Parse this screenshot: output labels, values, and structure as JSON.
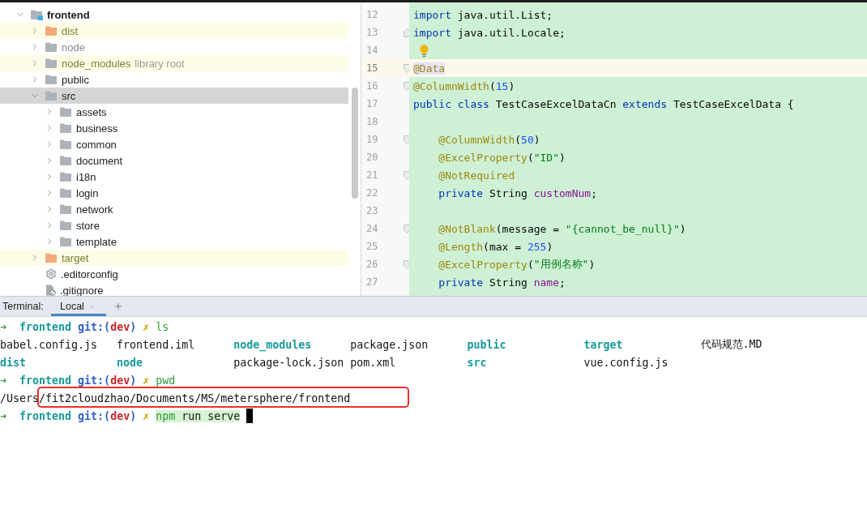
{
  "project_tree": {
    "items": [
      {
        "label": "frontend",
        "kind": "module",
        "expanded": true,
        "selected": false,
        "children": [
          {
            "label": "dist",
            "kind": "excluded-folder",
            "expanded": false,
            "selected": false
          },
          {
            "label": "node",
            "kind": "ignored-folder",
            "expanded": false,
            "selected": false
          },
          {
            "label": "node_modules",
            "hint": "library root",
            "kind": "library-folder",
            "expanded": false,
            "selected": false
          },
          {
            "label": "public",
            "kind": "folder",
            "expanded": false,
            "selected": false
          },
          {
            "label": "src",
            "kind": "folder",
            "expanded": true,
            "selected": true,
            "children": [
              {
                "label": "assets",
                "kind": "folder",
                "expanded": false,
                "selected": false
              },
              {
                "label": "business",
                "kind": "folder",
                "expanded": false,
                "selected": false
              },
              {
                "label": "common",
                "kind": "folder",
                "expanded": false,
                "selected": false
              },
              {
                "label": "document",
                "kind": "folder",
                "expanded": false,
                "selected": false
              },
              {
                "label": "i18n",
                "kind": "folder",
                "expanded": false,
                "selected": false
              },
              {
                "label": "login",
                "kind": "folder",
                "expanded": false,
                "selected": false
              },
              {
                "label": "network",
                "kind": "folder",
                "expanded": false,
                "selected": false
              },
              {
                "label": "store",
                "kind": "folder",
                "expanded": false,
                "selected": false
              },
              {
                "label": "template",
                "kind": "folder",
                "expanded": false,
                "selected": false
              }
            ]
          },
          {
            "label": "target",
            "kind": "excluded-folder",
            "expanded": false,
            "selected": false
          },
          {
            "label": ".editorconfig",
            "kind": "settings-file",
            "selected": false
          },
          {
            "label": ".gitignore",
            "kind": "ignore-file",
            "selected": false
          }
        ]
      }
    ]
  },
  "editor": {
    "lines": [
      {
        "number": "12",
        "current": false,
        "tokens": [
          {
            "text": "import",
            "kind": "keyword"
          },
          {
            "text": " java.util.List;",
            "kind": "plain"
          }
        ]
      },
      {
        "number": "13",
        "current": false,
        "fold": {
          "kind": "end"
        },
        "tokens": [
          {
            "text": "import",
            "kind": "keyword"
          },
          {
            "text": " java.util.Locale;",
            "kind": "plain"
          }
        ]
      },
      {
        "number": "14",
        "current": false,
        "bulb": true
      },
      {
        "number": "15",
        "current": true,
        "fold": {
          "kind": "start"
        },
        "tokens": [
          {
            "text": "@Data",
            "kind": "annotation",
            "marked": true
          }
        ]
      },
      {
        "number": "16",
        "current": false,
        "fold": {
          "kind": "start"
        },
        "tokens": [
          {
            "text": "@ColumnWidth",
            "kind": "annotation"
          },
          {
            "text": "(",
            "kind": "plain"
          },
          {
            "text": "15",
            "kind": "number"
          },
          {
            "text": ")",
            "kind": "plain"
          }
        ]
      },
      {
        "number": "17",
        "current": false,
        "tokens": [
          {
            "text": "public class",
            "kind": "keyword"
          },
          {
            "text": " TestCaseExcelDataCn ",
            "kind": "plain"
          },
          {
            "text": "extends",
            "kind": "keyword"
          },
          {
            "text": " TestCaseExcelData {",
            "kind": "plain"
          }
        ]
      },
      {
        "number": "18",
        "current": false
      },
      {
        "number": "19",
        "current": false,
        "fold": {
          "kind": "start"
        },
        "tokens": [
          {
            "text": "    @ColumnWidth",
            "kind": "annotation"
          },
          {
            "text": "(",
            "kind": "plain"
          },
          {
            "text": "50",
            "kind": "number"
          },
          {
            "text": ")",
            "kind": "plain"
          }
        ]
      },
      {
        "number": "20",
        "current": false,
        "tokens": [
          {
            "text": "    @ExcelProperty",
            "kind": "annotation"
          },
          {
            "text": "(",
            "kind": "plain"
          },
          {
            "text": "\"ID\"",
            "kind": "string"
          },
          {
            "text": ")",
            "kind": "plain"
          }
        ]
      },
      {
        "number": "21",
        "current": false,
        "fold": {
          "kind": "start"
        },
        "tokens": [
          {
            "text": "    @NotRequired",
            "kind": "annotation"
          }
        ]
      },
      {
        "number": "22",
        "current": false,
        "tokens": [
          {
            "text": "    private",
            "kind": "keyword"
          },
          {
            "text": " String ",
            "kind": "plain"
          },
          {
            "text": "customNum",
            "kind": "field"
          },
          {
            "text": ";",
            "kind": "plain"
          }
        ]
      },
      {
        "number": "23",
        "current": false
      },
      {
        "number": "24",
        "current": false,
        "fold": {
          "kind": "start"
        },
        "tokens": [
          {
            "text": "    @NotBlank",
            "kind": "annotation"
          },
          {
            "text": "(message = ",
            "kind": "plain"
          },
          {
            "text": "\"{cannot_be_null}\"",
            "kind": "string"
          },
          {
            "text": ")",
            "kind": "plain"
          }
        ]
      },
      {
        "number": "25",
        "current": false,
        "tokens": [
          {
            "text": "    @Length",
            "kind": "annotation"
          },
          {
            "text": "(max = ",
            "kind": "plain"
          },
          {
            "text": "255",
            "kind": "number"
          },
          {
            "text": ")",
            "kind": "plain"
          }
        ]
      },
      {
        "number": "26",
        "current": false,
        "fold": {
          "kind": "start"
        },
        "tokens": [
          {
            "text": "    @ExcelProperty",
            "kind": "annotation"
          },
          {
            "text": "(",
            "kind": "plain"
          },
          {
            "text": "\"用例名称\"",
            "kind": "string"
          },
          {
            "text": ")",
            "kind": "plain"
          }
        ]
      },
      {
        "number": "27",
        "current": false,
        "tokens": [
          {
            "text": "    private",
            "kind": "keyword"
          },
          {
            "text": " String ",
            "kind": "plain"
          },
          {
            "text": "name",
            "kind": "field"
          },
          {
            "text": ";",
            "kind": "plain"
          }
        ]
      }
    ]
  },
  "terminal": {
    "label": "Terminal:",
    "tabs": [
      {
        "label": "Local",
        "selected": true
      }
    ],
    "lines": [
      {
        "kind": "prompt",
        "arrow": "➜",
        "directory": "frontend",
        "git_open": "git:(",
        "branch": "dev",
        "git_close": ")",
        "dirty_mark": "✗",
        "command": "ls",
        "cursor": false
      },
      {
        "kind": "listing",
        "entries": [
          {
            "name": "babel.config.js",
            "kind": "file"
          },
          {
            "name": "frontend.iml",
            "kind": "file"
          },
          {
            "name": "node_modules",
            "kind": "directory"
          },
          {
            "name": "package.json",
            "kind": "file"
          },
          {
            "name": "public",
            "kind": "directory"
          },
          {
            "name": "target",
            "kind": "directory"
          },
          {
            "name": "代码规范.MD",
            "kind": "file"
          }
        ]
      },
      {
        "kind": "listing",
        "entries": [
          {
            "name": "dist",
            "kind": "directory"
          },
          {
            "name": "node",
            "kind": "directory"
          },
          {
            "name": "package-lock.json",
            "kind": "file"
          },
          {
            "name": "pom.xml",
            "kind": "file"
          },
          {
            "name": "src",
            "kind": "directory"
          },
          {
            "name": "vue.config.js",
            "kind": "file"
          }
        ]
      },
      {
        "kind": "prompt",
        "arrow": "➜",
        "directory": "frontend",
        "git_open": "git:(",
        "branch": "dev",
        "git_close": ")",
        "dirty_mark": "✗",
        "command": "pwd",
        "cursor": false
      },
      {
        "kind": "output",
        "text": "/Users/fit2cloudzhao/Documents/MS/metersphere/frontend",
        "outlined": true
      },
      {
        "kind": "prompt",
        "arrow": "➜",
        "directory": "frontend",
        "git_open": "git:(",
        "branch": "dev",
        "git_close": ")",
        "dirty_mark": "✗",
        "command": "npm",
        "arguments": "run serve",
        "cursor": true
      }
    ]
  }
}
